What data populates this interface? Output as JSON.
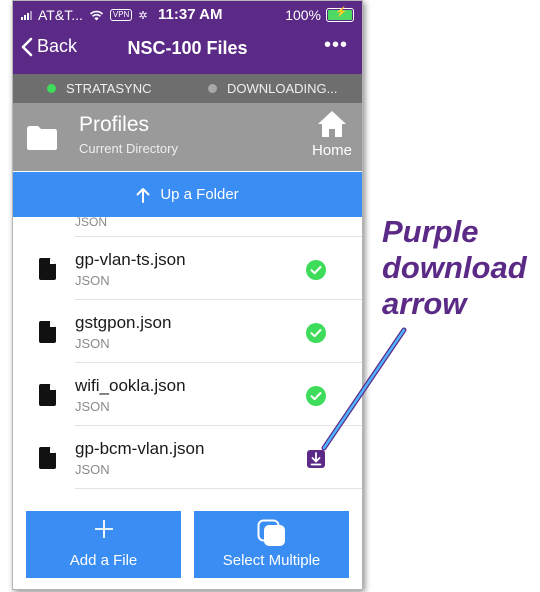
{
  "status": {
    "carrier": "AT&T...",
    "vpn": "VPN",
    "time": "11:37 AM",
    "battery": "100%"
  },
  "nav": {
    "back_label": "Back",
    "title": "NSC-100 Files",
    "more": "•••"
  },
  "sync": [
    {
      "label": "STRATASYNC",
      "color": "#3ddc5a"
    },
    {
      "label": "DOWNLOADING...",
      "color": "#a8a8a8"
    }
  ],
  "directory": {
    "name": "Profiles",
    "subtitle": "Current Directory",
    "home_label": "Home"
  },
  "up_folder": {
    "label": "Up a Folder"
  },
  "list": {
    "peek_type": "JSON",
    "files": [
      {
        "name": "gp-vlan-ts.json",
        "type": "JSON",
        "status": "downloaded"
      },
      {
        "name": "gstgpon.json",
        "type": "JSON",
        "status": "downloaded"
      },
      {
        "name": "wifi_ookla.json",
        "type": "JSON",
        "status": "downloaded"
      },
      {
        "name": "gp-bcm-vlan.json",
        "type": "JSON",
        "status": "download"
      }
    ]
  },
  "buttons": {
    "add_file": "Add a File",
    "select_multiple": "Select Multiple"
  },
  "annotation": {
    "line1": "Purple",
    "line2": "download",
    "line3": "arrow"
  },
  "colors": {
    "brand_purple": "#5b2a86",
    "accent_blue": "#3a8df3",
    "success_green": "#3ddc5a",
    "header_gray": "#9a9a9a"
  }
}
